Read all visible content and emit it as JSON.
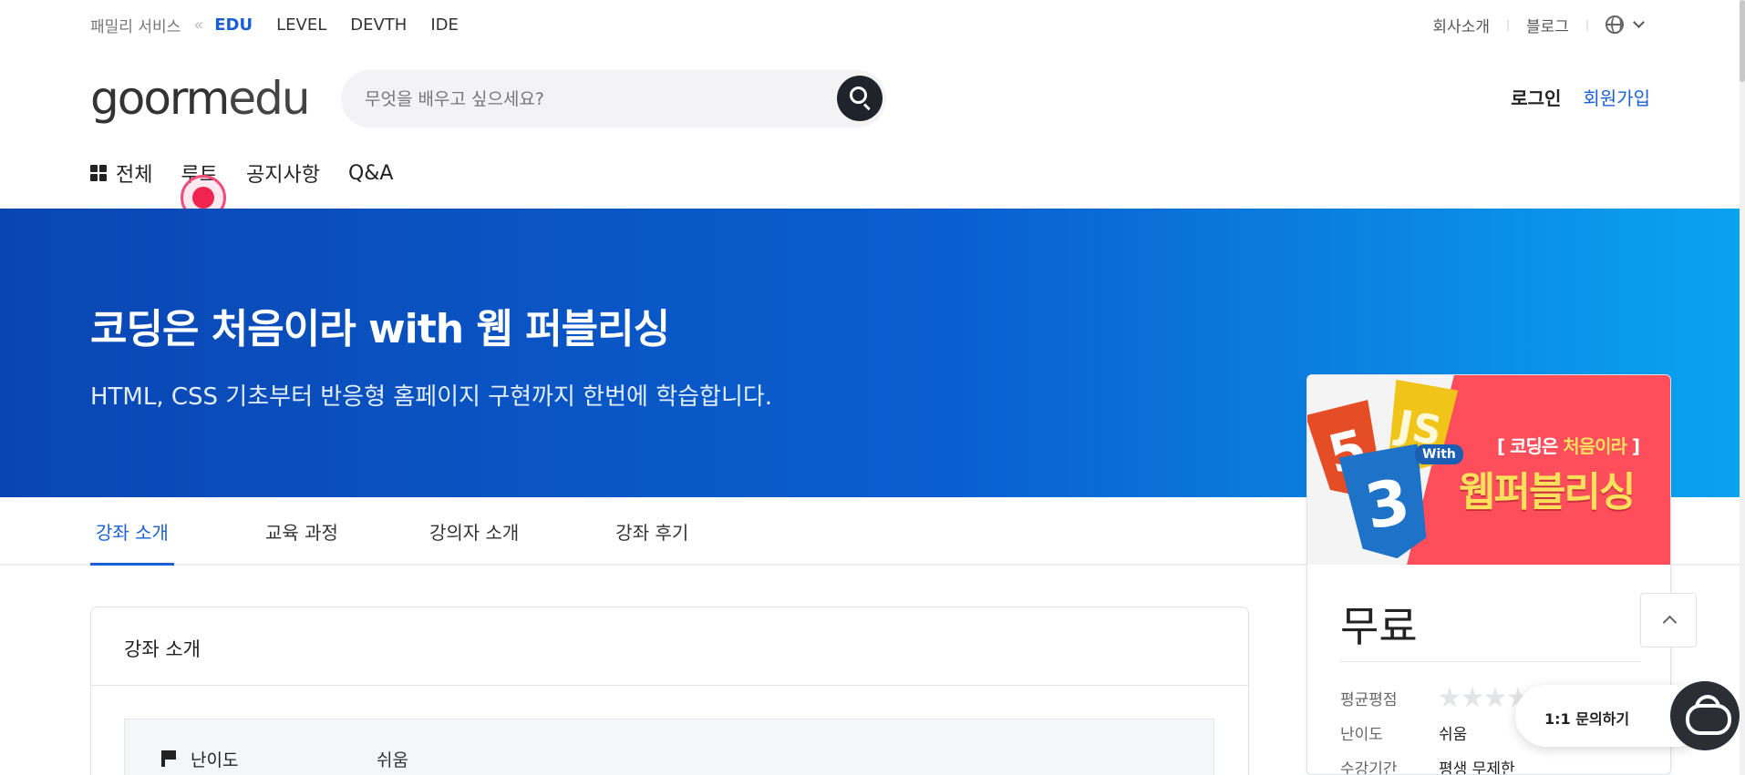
{
  "family_bar": {
    "label": "패밀리 서비스",
    "links": [
      "EDU",
      "LEVEL",
      "DEVTH",
      "IDE"
    ]
  },
  "util": {
    "company": "회사소개",
    "blog": "블로그"
  },
  "logo": {
    "part1": "goorm",
    "part2": "edu"
  },
  "search": {
    "placeholder": "무엇을 배우고 싶으세요?"
  },
  "auth": {
    "login": "로그인",
    "signup": "회원가입"
  },
  "nav": {
    "all": "전체",
    "items": [
      "루트",
      "공지사항",
      "Q&A"
    ]
  },
  "hero": {
    "title": "코딩은 처음이라 with 웹 퍼블리싱",
    "subtitle": "HTML, CSS 기초부터 반응형 홈페이지 구현까지 한번에 학습합니다."
  },
  "thumbnail": {
    "html_glyph": "5",
    "js_glyph": "JS",
    "css_glyph": "3",
    "with": "With",
    "sub_open": "[ 코딩은 ",
    "sub_highlight": "처음이라",
    "sub_close": " ]",
    "main": "웹퍼블리싱"
  },
  "card": {
    "price": "무료",
    "rating_label": "평균평점",
    "rating_value": 0,
    "difficulty_label": "난이도",
    "difficulty_value": "쉬움",
    "period_label": "수강기간",
    "period_value": "평생 무제한"
  },
  "chat": {
    "label": "1:1 문의하기"
  },
  "tabs": [
    "강좌 소개",
    "교육 과정",
    "강의자 소개",
    "강좌 후기"
  ],
  "content": {
    "title": "강좌 소개",
    "difficulty_label": "난이도",
    "difficulty_value": "쉬움"
  },
  "colors": {
    "brand_blue": "#1a5fd6",
    "hero_start": "#0a46b3",
    "hero_end": "#0aa3f0",
    "thumb_red": "#ff4e5b"
  }
}
